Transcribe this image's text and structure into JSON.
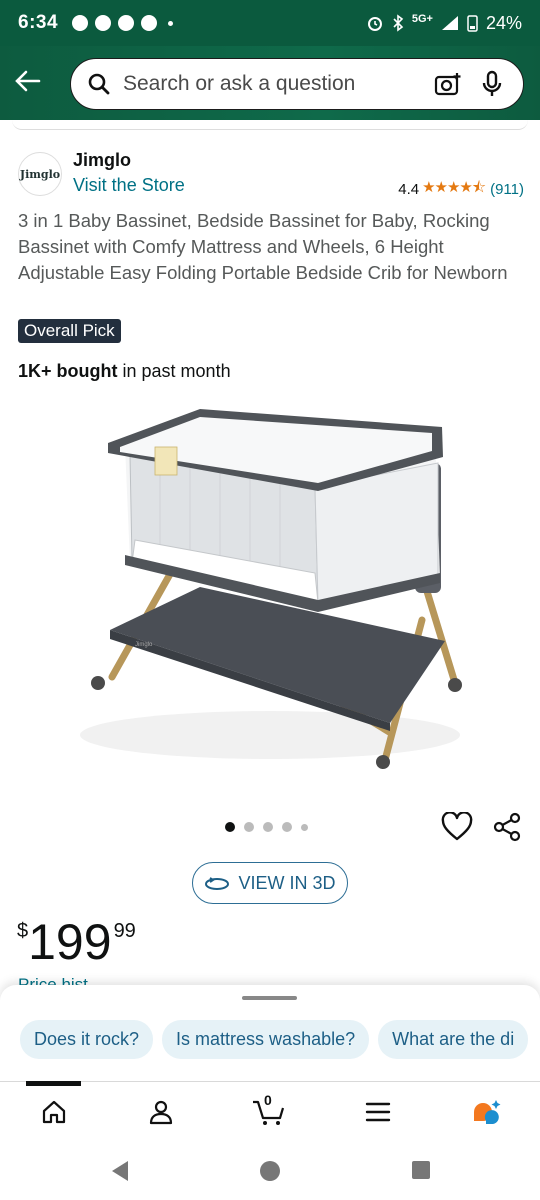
{
  "status_bar": {
    "time": "6:34",
    "network": "5G+",
    "battery": "24%"
  },
  "search": {
    "placeholder": "Search or ask a question"
  },
  "brand": {
    "logo_text": "Jimglo",
    "name": "Jimglo",
    "visit_store": "Visit the Store"
  },
  "rating": {
    "value": "4.4",
    "stars": 4.5,
    "count": "(911)"
  },
  "product": {
    "title": "3 in 1 Baby Bassinet, Bedside Bassinet for Baby, Rocking Bassinet with Comfy Mattress and Wheels, 6 Height Adjustable Easy Folding Portable Bedside Crib for Newborn",
    "badge": "Overall Pick",
    "bought_bold": "1K+ bought",
    "bought_rest": "in past month",
    "image_label": "Jimglo"
  },
  "gallery": {
    "total_images": 5,
    "active_index": 0
  },
  "view_3d_label": "VIEW IN 3D",
  "price": {
    "currency": "$",
    "whole": "199",
    "fraction": "99"
  },
  "price_link_partial": "Price hist...",
  "question_chips": [
    "Does it rock?",
    "Is mattress washable?",
    "What are the di"
  ],
  "bottom_nav": {
    "cart_count": "0",
    "active": "home"
  },
  "colors": {
    "header_green": "#0d5b3f",
    "link_teal": "#007185",
    "star_orange": "#e47911",
    "chip_bg": "#e6f2f7",
    "badge_bg": "#232f3e"
  }
}
